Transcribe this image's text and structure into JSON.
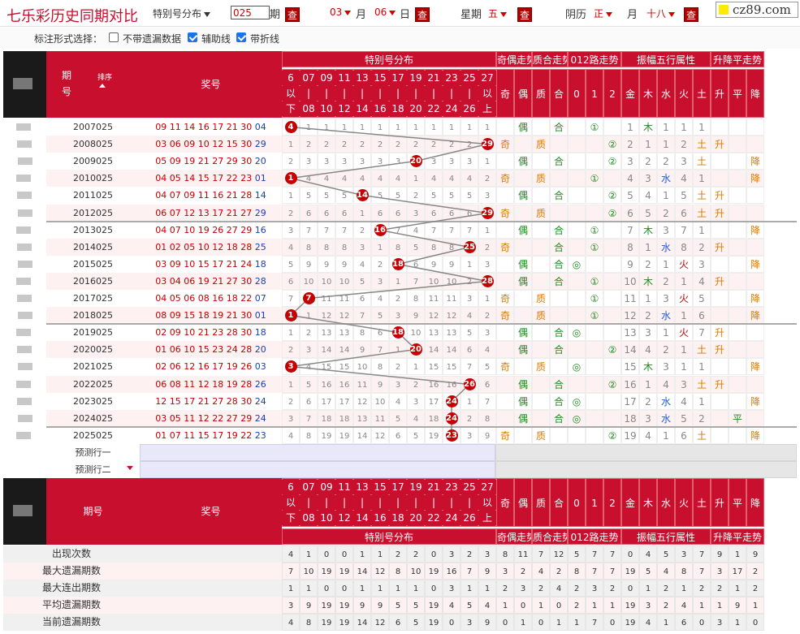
{
  "title": "七乐彩历史同期对比",
  "toolbar": {
    "mode": "特别号分布",
    "period_value": "025",
    "period_label": "期",
    "month_value": "03",
    "month_label": "月",
    "day_value": "06",
    "day_label": "日",
    "week_label": "星期",
    "week_value": "五",
    "lunar_label": "阴历",
    "lunar_month": "正",
    "lunar_month_label": "月",
    "lunar_day": "十八",
    "query": "查",
    "site": "cz89.com"
  },
  "options": {
    "label": "标注形式选择：",
    "items": [
      {
        "label": "不带遗漏数据",
        "checked": false
      },
      {
        "label": "辅助线",
        "checked": true
      },
      {
        "label": "带折线",
        "checked": true
      }
    ]
  },
  "header": {
    "period": "期号",
    "period_top": "期",
    "period_bottom": "号",
    "sort": "排序",
    "prize": "奖号",
    "special_group": "特别号分布",
    "odd_group": "奇偶走势",
    "prime_group": "质合走势",
    "route_group": "012路走势",
    "wuxing_group": "振幅五行属性",
    "rise_group": "升降平走势",
    "special_cols": [
      [
        "6",
        "以",
        "下"
      ],
      [
        "07",
        "|",
        "08"
      ],
      [
        "09",
        "|",
        "10"
      ],
      [
        "11",
        "|",
        "12"
      ],
      [
        "13",
        "|",
        "14"
      ],
      [
        "15",
        "|",
        "16"
      ],
      [
        "17",
        "|",
        "18"
      ],
      [
        "19",
        "|",
        "20"
      ],
      [
        "21",
        "|",
        "22"
      ],
      [
        "23",
        "|",
        "24"
      ],
      [
        "25",
        "|",
        "26"
      ],
      [
        "27",
        "以",
        "上"
      ]
    ],
    "odd_cols": [
      "奇",
      "偶"
    ],
    "prime_cols": [
      "质",
      "合"
    ],
    "route_cols": [
      "0",
      "1",
      "2"
    ],
    "wuxing_cols": [
      "金",
      "木",
      "水",
      "火",
      "土"
    ],
    "rise_cols": [
      "升",
      "平",
      "降"
    ]
  },
  "rows": [
    {
      "period": "2007025",
      "nums": "09 11 14 16 17 21 30",
      "sp": "04",
      "cells": [
        "4",
        "1",
        "1",
        "1",
        "1",
        "1",
        "1",
        "1",
        "1",
        "1",
        "1",
        "1"
      ],
      "odd": [
        "",
        "偶"
      ],
      "prime": [
        "",
        "合"
      ],
      "route": [
        "",
        "①",
        ""
      ],
      "wx": [
        "1",
        "木",
        "1",
        "1",
        "1"
      ],
      "rise": [
        "",
        "",
        ""
      ]
    },
    {
      "period": "2008025",
      "nums": "03 06 09 10 12 15 30",
      "sp": "29",
      "cells": [
        "1",
        "2",
        "2",
        "2",
        "2",
        "2",
        "2",
        "2",
        "2",
        "2",
        "2",
        "29"
      ],
      "odd": [
        "奇",
        ""
      ],
      "prime": [
        "质",
        ""
      ],
      "route": [
        "",
        "",
        "②"
      ],
      "wx": [
        "2",
        "1",
        "1",
        "2",
        "土"
      ],
      "rise": [
        "升",
        "",
        ""
      ]
    },
    {
      "period": "2009025",
      "nums": "05 09 19 21 27 29 30",
      "sp": "20",
      "cells": [
        "2",
        "3",
        "3",
        "3",
        "3",
        "3",
        "3",
        "20",
        "3",
        "3",
        "3",
        "1"
      ],
      "odd": [
        "",
        "偶"
      ],
      "prime": [
        "",
        "合"
      ],
      "route": [
        "",
        "",
        "②"
      ],
      "wx": [
        "3",
        "2",
        "2",
        "3",
        "土"
      ],
      "rise": [
        "",
        "",
        "降"
      ]
    },
    {
      "period": "2010025",
      "nums": "04 05 14 15 17 22 23",
      "sp": "01",
      "cells": [
        "1",
        "4",
        "4",
        "4",
        "4",
        "4",
        "4",
        "1",
        "4",
        "4",
        "4",
        "2"
      ],
      "odd": [
        "奇",
        ""
      ],
      "prime": [
        "质",
        ""
      ],
      "route": [
        "",
        "①",
        ""
      ],
      "wx": [
        "4",
        "3",
        "水",
        "4",
        "1"
      ],
      "rise": [
        "",
        "",
        "降"
      ]
    },
    {
      "period": "2011025",
      "nums": "04 07 09 11 16 21 28",
      "sp": "14",
      "cells": [
        "1",
        "5",
        "5",
        "5",
        "14",
        "5",
        "5",
        "2",
        "5",
        "5",
        "5",
        "3"
      ],
      "odd": [
        "",
        "偶"
      ],
      "prime": [
        "",
        "合"
      ],
      "route": [
        "",
        "",
        "②"
      ],
      "wx": [
        "5",
        "4",
        "1",
        "5",
        "土"
      ],
      "rise": [
        "升",
        "",
        ""
      ]
    },
    {
      "period": "2012025",
      "nums": "06 07 12 13 17 21 27",
      "sp": "29",
      "cells": [
        "2",
        "6",
        "6",
        "6",
        "1",
        "6",
        "6",
        "3",
        "6",
        "6",
        "6",
        "29"
      ],
      "odd": [
        "奇",
        ""
      ],
      "prime": [
        "质",
        ""
      ],
      "route": [
        "",
        "",
        "②"
      ],
      "wx": [
        "6",
        "5",
        "2",
        "6",
        "土"
      ],
      "rise": [
        "升",
        "",
        ""
      ]
    },
    {
      "period": "2013025",
      "nums": "04 07 10 19 26 27 29",
      "sp": "16",
      "cells": [
        "3",
        "7",
        "7",
        "7",
        "2",
        "16",
        "7",
        "4",
        "7",
        "7",
        "7",
        "1"
      ],
      "odd": [
        "",
        "偶"
      ],
      "prime": [
        "",
        "合"
      ],
      "route": [
        "",
        "①",
        ""
      ],
      "wx": [
        "7",
        "木",
        "3",
        "7",
        "1"
      ],
      "rise": [
        "",
        "",
        "降"
      ]
    },
    {
      "period": "2014025",
      "nums": "01 02 05 10 12 18 28",
      "sp": "25",
      "cells": [
        "4",
        "8",
        "8",
        "8",
        "3",
        "1",
        "8",
        "5",
        "8",
        "8",
        "25",
        "2"
      ],
      "odd": [
        "奇",
        ""
      ],
      "prime": [
        "",
        "合"
      ],
      "route": [
        "",
        "①",
        ""
      ],
      "wx": [
        "8",
        "1",
        "水",
        "8",
        "2"
      ],
      "rise": [
        "升",
        "",
        ""
      ]
    },
    {
      "period": "2015025",
      "nums": "03 09 10 15 17 21 24",
      "sp": "18",
      "cells": [
        "5",
        "9",
        "9",
        "9",
        "4",
        "2",
        "18",
        "6",
        "9",
        "9",
        "1",
        "3"
      ],
      "odd": [
        "",
        "偶"
      ],
      "prime": [
        "",
        "合"
      ],
      "route": [
        "◎",
        "",
        ""
      ],
      "wx": [
        "9",
        "2",
        "1",
        "火",
        "3"
      ],
      "rise": [
        "",
        "",
        "降"
      ]
    },
    {
      "period": "2016025",
      "nums": "03 04 06 19 21 27 30",
      "sp": "28",
      "cells": [
        "6",
        "10",
        "10",
        "10",
        "5",
        "3",
        "1",
        "7",
        "10",
        "10",
        "2",
        "28"
      ],
      "odd": [
        "",
        "偶"
      ],
      "prime": [
        "",
        "合"
      ],
      "route": [
        "",
        "①",
        ""
      ],
      "wx": [
        "10",
        "木",
        "2",
        "1",
        "4"
      ],
      "rise": [
        "升",
        "",
        ""
      ]
    },
    {
      "period": "2017025",
      "nums": "04 05 06 08 16 18 22",
      "sp": "07",
      "cells": [
        "7",
        "7",
        "11",
        "11",
        "6",
        "4",
        "2",
        "8",
        "11",
        "11",
        "3",
        "1"
      ],
      "odd": [
        "奇",
        ""
      ],
      "prime": [
        "质",
        ""
      ],
      "route": [
        "",
        "①",
        ""
      ],
      "wx": [
        "11",
        "1",
        "3",
        "火",
        "5"
      ],
      "rise": [
        "",
        "",
        "降"
      ]
    },
    {
      "period": "2018025",
      "nums": "08 09 15 18 19 21 30",
      "sp": "01",
      "cells": [
        "1",
        "1",
        "12",
        "12",
        "7",
        "5",
        "3",
        "9",
        "12",
        "12",
        "4",
        "2"
      ],
      "odd": [
        "奇",
        ""
      ],
      "prime": [
        "质",
        ""
      ],
      "route": [
        "",
        "①",
        ""
      ],
      "wx": [
        "12",
        "2",
        "水",
        "1",
        "6"
      ],
      "rise": [
        "",
        "",
        "降"
      ]
    },
    {
      "period": "2019025",
      "nums": "02 09 10 21 23 28 30",
      "sp": "18",
      "cells": [
        "1",
        "2",
        "13",
        "13",
        "8",
        "6",
        "18",
        "10",
        "13",
        "13",
        "5",
        "3"
      ],
      "odd": [
        "",
        "偶"
      ],
      "prime": [
        "",
        "合"
      ],
      "route": [
        "◎",
        "",
        ""
      ],
      "wx": [
        "13",
        "3",
        "1",
        "火",
        "7"
      ],
      "rise": [
        "升",
        "",
        ""
      ]
    },
    {
      "period": "2020025",
      "nums": "01 06 10 15 23 24 28",
      "sp": "20",
      "cells": [
        "2",
        "3",
        "14",
        "14",
        "9",
        "7",
        "1",
        "20",
        "14",
        "14",
        "6",
        "4"
      ],
      "odd": [
        "",
        "偶"
      ],
      "prime": [
        "",
        "合"
      ],
      "route": [
        "",
        "",
        "②"
      ],
      "wx": [
        "14",
        "4",
        "2",
        "1",
        "土"
      ],
      "rise": [
        "升",
        "",
        ""
      ]
    },
    {
      "period": "2021025",
      "nums": "02 06 12 16 17 19 26",
      "sp": "03",
      "cells": [
        "3",
        "4",
        "15",
        "15",
        "10",
        "8",
        "2",
        "1",
        "15",
        "15",
        "7",
        "5"
      ],
      "odd": [
        "奇",
        ""
      ],
      "prime": [
        "质",
        ""
      ],
      "route": [
        "◎",
        "",
        ""
      ],
      "wx": [
        "15",
        "木",
        "3",
        "1",
        "1"
      ],
      "rise": [
        "",
        "",
        "降"
      ]
    },
    {
      "period": "2022025",
      "nums": "06 08 11 12 18 19 28",
      "sp": "26",
      "cells": [
        "1",
        "5",
        "16",
        "16",
        "11",
        "9",
        "3",
        "2",
        "16",
        "16",
        "26",
        "6"
      ],
      "odd": [
        "",
        "偶"
      ],
      "prime": [
        "",
        "合"
      ],
      "route": [
        "",
        "",
        "②"
      ],
      "wx": [
        "16",
        "1",
        "4",
        "3",
        "土"
      ],
      "rise": [
        "升",
        "",
        ""
      ]
    },
    {
      "period": "2023025",
      "nums": "12 15 17 21 27 28 30",
      "sp": "24",
      "cells": [
        "2",
        "6",
        "17",
        "17",
        "12",
        "10",
        "4",
        "3",
        "17",
        "24",
        "1",
        "7"
      ],
      "odd": [
        "",
        "偶"
      ],
      "prime": [
        "",
        "合"
      ],
      "route": [
        "◎",
        "",
        ""
      ],
      "wx": [
        "17",
        "2",
        "水",
        "4",
        "1"
      ],
      "rise": [
        "",
        "",
        "降"
      ]
    },
    {
      "period": "2024025",
      "nums": "03 05 11 12 22 27 29",
      "sp": "24",
      "cells": [
        "3",
        "7",
        "18",
        "18",
        "13",
        "11",
        "5",
        "4",
        "18",
        "24",
        "2",
        "8"
      ],
      "odd": [
        "",
        "偶"
      ],
      "prime": [
        "",
        "合"
      ],
      "route": [
        "◎",
        "",
        ""
      ],
      "wx": [
        "18",
        "3",
        "水",
        "5",
        "2"
      ],
      "rise": [
        "",
        "平",
        ""
      ]
    },
    {
      "period": "2025025",
      "nums": "01 07 11 15 17 19 22",
      "sp": "23",
      "cells": [
        "4",
        "8",
        "19",
        "19",
        "14",
        "12",
        "6",
        "5",
        "19",
        "23",
        "3",
        "9"
      ],
      "odd": [
        "奇",
        ""
      ],
      "prime": [
        "质",
        ""
      ],
      "route": [
        "",
        "",
        "②"
      ],
      "wx": [
        "19",
        "4",
        "1",
        "6",
        "土"
      ],
      "rise": [
        "",
        "",
        "降"
      ]
    }
  ],
  "ball_cols": [
    0,
    11,
    7,
    0,
    4,
    11,
    5,
    10,
    6,
    11,
    1,
    0,
    6,
    7,
    0,
    10,
    9,
    9,
    9
  ],
  "predict": [
    "预测行一",
    "预测行二"
  ],
  "stats": [
    {
      "label": "出现次数",
      "values": [
        "4",
        "1",
        "0",
        "0",
        "1",
        "1",
        "2",
        "2",
        "0",
        "3",
        "2",
        "3",
        "8",
        "11",
        "7",
        "12",
        "5",
        "7",
        "7",
        "0",
        "4",
        "5",
        "3",
        "7",
        "9",
        "1",
        "9"
      ]
    },
    {
      "label": "最大遗漏期数",
      "values": [
        "7",
        "10",
        "19",
        "19",
        "14",
        "12",
        "8",
        "10",
        "19",
        "16",
        "7",
        "9",
        "3",
        "2",
        "4",
        "2",
        "8",
        "7",
        "7",
        "19",
        "5",
        "4",
        "8",
        "7",
        "3",
        "17",
        "2"
      ]
    },
    {
      "label": "最大连出期数",
      "values": [
        "1",
        "1",
        "0",
        "0",
        "1",
        "1",
        "1",
        "1",
        "0",
        "3",
        "1",
        "1",
        "2",
        "3",
        "2",
        "4",
        "2",
        "3",
        "2",
        "0",
        "1",
        "2",
        "1",
        "2",
        "2",
        "1",
        "2"
      ]
    },
    {
      "label": "平均遗漏期数",
      "values": [
        "3",
        "9",
        "19",
        "19",
        "9",
        "9",
        "5",
        "5",
        "19",
        "4",
        "5",
        "4",
        "1",
        "0",
        "1",
        "0",
        "2",
        "1",
        "1",
        "19",
        "3",
        "2",
        "4",
        "1",
        "1",
        "9",
        "1"
      ]
    },
    {
      "label": "当前遗漏期数",
      "values": [
        "4",
        "8",
        "19",
        "19",
        "14",
        "12",
        "6",
        "5",
        "19",
        "0",
        "3",
        "9",
        "0",
        "1",
        "0",
        "1",
        "1",
        "7",
        "0",
        "19",
        "4",
        "1",
        "6",
        "0",
        "3",
        "1",
        "0"
      ]
    }
  ],
  "colors": {
    "header": "#c8102e",
    "ball": "#c40000",
    "green": "#228b22",
    "blue": "#1e5fd8",
    "orange": "#d97a00",
    "row_alt": "#fdf1f1",
    "predict_bg": "#e8e8f8"
  }
}
